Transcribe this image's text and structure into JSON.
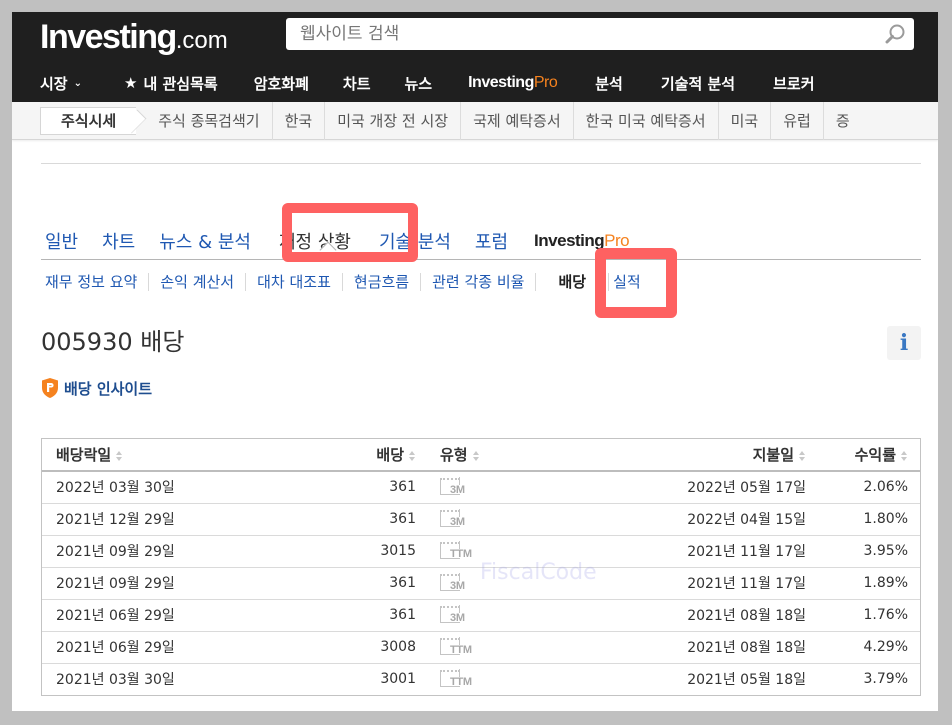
{
  "header": {
    "logo_main": "Investing",
    "logo_suffix": ".com",
    "search_placeholder": "웹사이트 검색",
    "nav": [
      {
        "label": "시장",
        "has_dropdown": true
      },
      {
        "label": "내 관심목록",
        "icon": "star-icon"
      },
      {
        "label": "암호화폐"
      },
      {
        "label": "차트"
      },
      {
        "label": "뉴스"
      },
      {
        "label_main": "Investing",
        "label_accent": "Pro"
      },
      {
        "label": "분석"
      },
      {
        "label": "기술적 분석"
      },
      {
        "label": "브로커"
      }
    ]
  },
  "subnav": {
    "items": [
      "주식시세",
      "주식 종목검색기",
      "한국",
      "미국 개장 전 시장",
      "국제 예탁증서",
      "한국 미국 예탁증서",
      "미국",
      "유럽",
      "증"
    ]
  },
  "section_tabs": {
    "items": [
      "일반",
      "차트",
      "뉴스 & 분석",
      "재정 상황",
      "기술 분석",
      "포럼"
    ],
    "pro_main": "Investing",
    "pro_accent": "Pro",
    "active": "재정 상황"
  },
  "sub_tabs": {
    "items": [
      "재무 정보 요약",
      "손익 계산서",
      "대차 대조표",
      "현금흐름",
      "관련 각종 비율",
      "배당",
      "실적"
    ],
    "active": "배당"
  },
  "page": {
    "title": "005930 배당",
    "info_label": "i",
    "insight_label": "배당 인사이트"
  },
  "table": {
    "headers": {
      "ex_date": "배당락일",
      "amount": "배당",
      "type": "유형",
      "pay_date": "지불일",
      "yield": "수익률"
    },
    "rows": [
      {
        "ex_date": "2022년 03월 30일",
        "amount": "361",
        "type": "3M",
        "pay_date": "2022년 05월 17일",
        "yield": "2.06%"
      },
      {
        "ex_date": "2021년 12월 29일",
        "amount": "361",
        "type": "3M",
        "pay_date": "2022년 04월 15일",
        "yield": "1.80%"
      },
      {
        "ex_date": "2021년 09월 29일",
        "amount": "3015",
        "type": "TTM",
        "pay_date": "2021년 11월 17일",
        "yield": "3.95%"
      },
      {
        "ex_date": "2021년 09월 29일",
        "amount": "361",
        "type": "3M",
        "pay_date": "2021년 11월 17일",
        "yield": "1.89%"
      },
      {
        "ex_date": "2021년 06월 29일",
        "amount": "361",
        "type": "3M",
        "pay_date": "2021년 08월 18일",
        "yield": "1.76%"
      },
      {
        "ex_date": "2021년 06월 29일",
        "amount": "3008",
        "type": "TTM",
        "pay_date": "2021년 08월 18일",
        "yield": "4.29%"
      },
      {
        "ex_date": "2021년 03월 30일",
        "amount": "3001",
        "type": "TTM",
        "pay_date": "2021년 05월 18일",
        "yield": "3.79%"
      }
    ]
  },
  "watermark": "FiscalCode",
  "colors": {
    "header_bg": "#1f1f1f",
    "pro_orange": "#f5821f",
    "link_blue": "#1f58b2",
    "highlight_red": "#fe6161"
  }
}
